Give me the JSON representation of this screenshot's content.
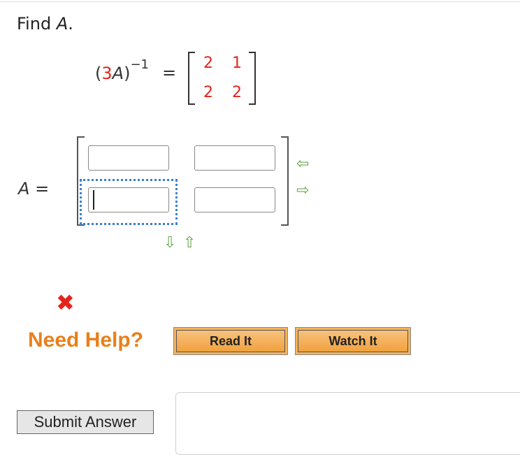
{
  "question": {
    "prompt_prefix": "Find ",
    "prompt_var": "A",
    "prompt_suffix": "."
  },
  "equation": {
    "lhs_open": "(",
    "lhs_coef": "3",
    "lhs_var": "A",
    "lhs_close": ")",
    "lhs_exponent": "−1",
    "equals": "=",
    "matrix": [
      [
        "2",
        "1"
      ],
      [
        "2",
        "2"
      ]
    ]
  },
  "answer": {
    "label_var": "A",
    "label_equals": "=",
    "cells": [
      [
        "",
        ""
      ],
      [
        "",
        ""
      ]
    ]
  },
  "status": {
    "result_mark": "✖"
  },
  "help": {
    "label": "Need Help?",
    "read_button": "Read It",
    "watch_button": "Watch It"
  },
  "submit": {
    "label": "Submit Answer"
  },
  "colors": {
    "given_value": "#e3251c",
    "help": "#e8801b",
    "button": "#f7b25a",
    "arrows": "#6aa84f",
    "focus": "#3a7fd5"
  },
  "icons": [
    "insert-row-left-icon",
    "insert-row-right-icon",
    "remove-row-down-icon",
    "add-row-up-icon",
    "incorrect-x-icon"
  ]
}
